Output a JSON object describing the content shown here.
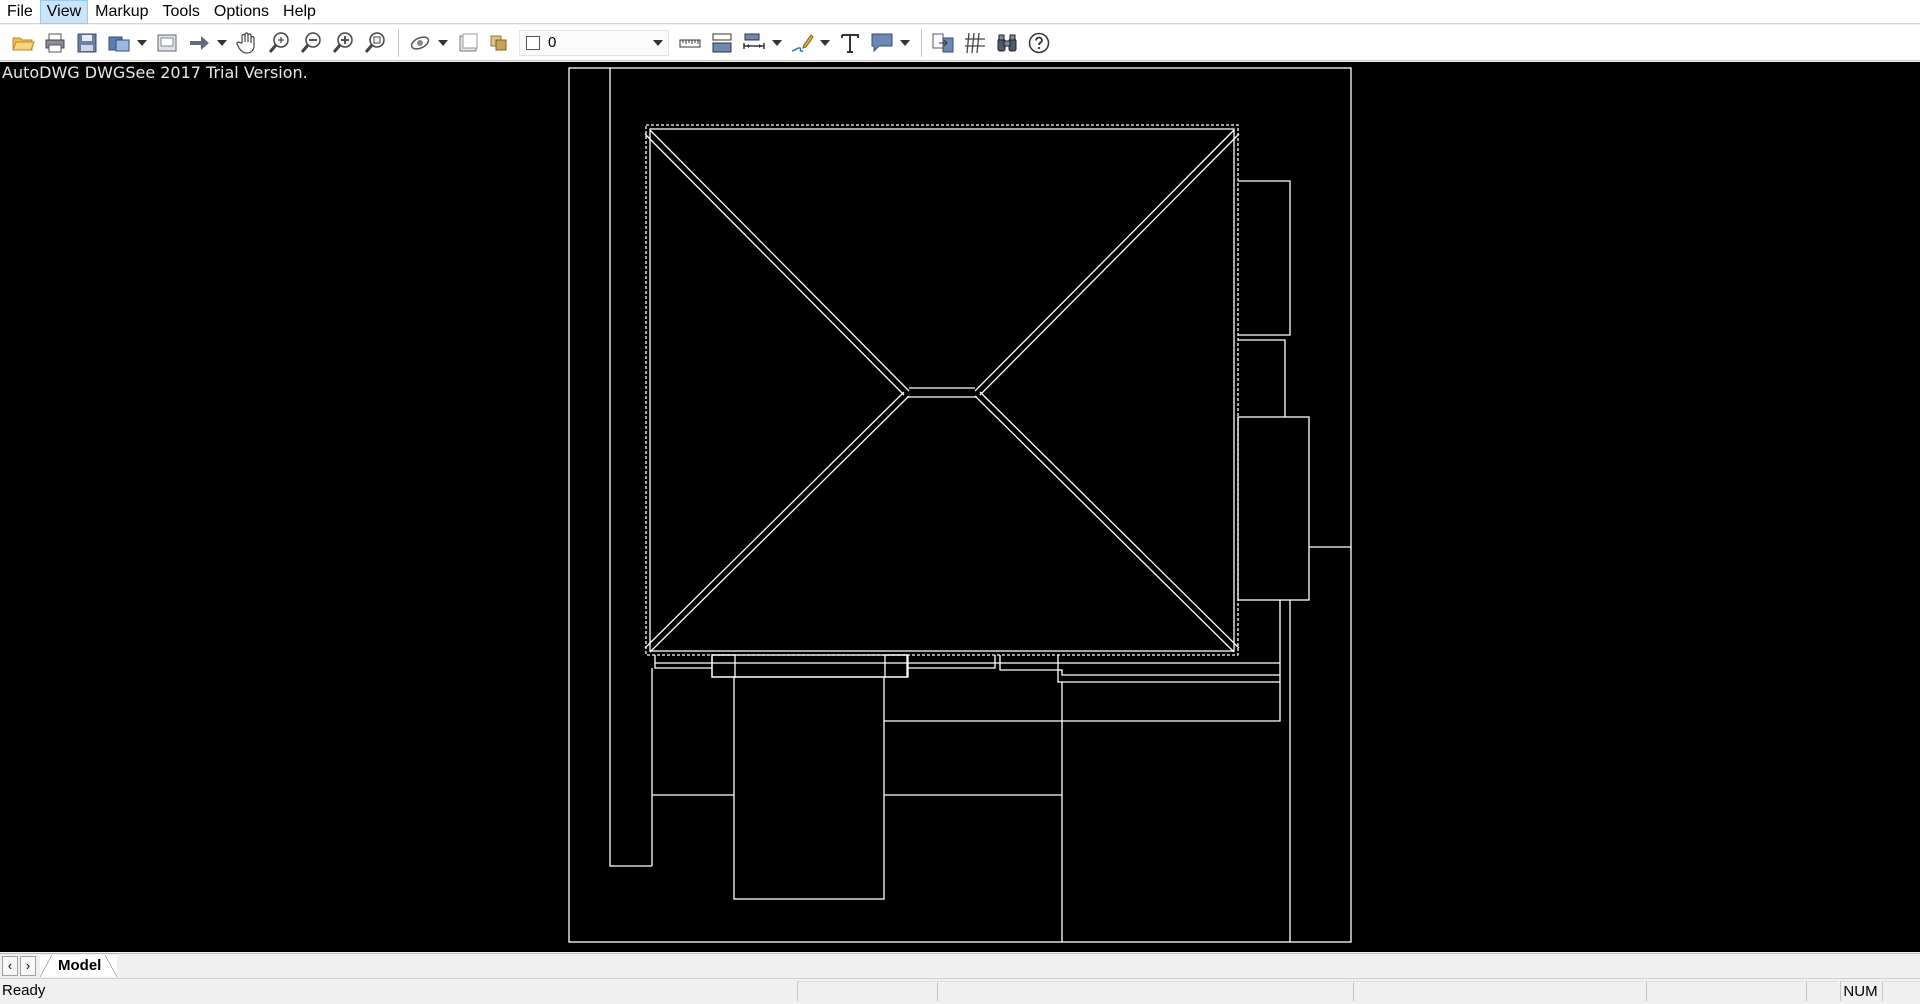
{
  "menu": {
    "items": [
      "File",
      "View",
      "Markup",
      "Tools",
      "Options",
      "Help"
    ],
    "active_index": 1
  },
  "toolbar": {
    "buttons": [
      {
        "icon": "open-folder-icon"
      },
      {
        "icon": "print-icon"
      },
      {
        "icon": "save-icon"
      },
      {
        "icon": "export-icon",
        "dropdown": true
      },
      {
        "icon": "page-setup-icon"
      },
      {
        "icon": "forward-arrow-icon",
        "dropdown": true
      },
      {
        "icon": "pan-hand-icon"
      },
      {
        "icon": "zoom-realtime-icon"
      },
      {
        "icon": "zoom-out-icon"
      },
      {
        "icon": "zoom-in-icon"
      },
      {
        "icon": "zoom-extents-icon"
      },
      {
        "icon": "orbit-icon",
        "dropdown": true
      },
      {
        "icon": "background-color-icon"
      },
      {
        "icon": "layers-icon"
      }
    ],
    "layer_value": "0",
    "buttons_right": [
      {
        "icon": "measure-distance-icon"
      },
      {
        "icon": "measure-area-icon"
      },
      {
        "icon": "dimension-icon",
        "dropdown": true
      },
      {
        "icon": "pen-markup-icon",
        "dropdown": true
      },
      {
        "icon": "text-icon"
      },
      {
        "icon": "callout-icon",
        "dropdown": true
      },
      {
        "icon": "compare-icon"
      },
      {
        "icon": "hatch-icon"
      },
      {
        "icon": "find-binoculars-icon"
      },
      {
        "icon": "help-icon"
      }
    ]
  },
  "canvas": {
    "watermark": "AutoDWG DWGSee 2017 Trial Version.",
    "background": "#000000",
    "line_color": "#ffffff"
  },
  "tabs": {
    "items": [
      "Model"
    ]
  },
  "status": {
    "text": "Ready",
    "num_indicator": "NUM"
  }
}
